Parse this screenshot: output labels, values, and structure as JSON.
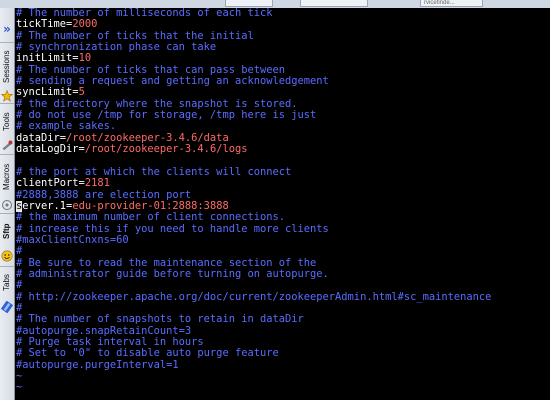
{
  "topbar": {
    "tabs": [
      "",
      "",
      "rvicefinde..."
    ]
  },
  "sidebar": {
    "tabs": [
      {
        "label": "Sessions",
        "icon": "star-icon"
      },
      {
        "label": "Tools",
        "icon": "tools-icon"
      },
      {
        "label": "Macros",
        "icon": "macros-icon"
      },
      {
        "label": "Sftp",
        "icon": "sftp-icon"
      },
      {
        "label": "Tabs",
        "icon": "tabs-icon"
      }
    ]
  },
  "terminal": {
    "lines": [
      {
        "type": "comment",
        "text": "# The number of milliseconds of each tick"
      },
      {
        "type": "kv",
        "key": "tickTime=",
        "value": "2000"
      },
      {
        "type": "comment",
        "text": "# The number of ticks that the initial"
      },
      {
        "type": "comment",
        "text": "# synchronization phase can take"
      },
      {
        "type": "kv",
        "key": "initLimit=",
        "value": "10"
      },
      {
        "type": "comment",
        "text": "# The number of ticks that can pass between"
      },
      {
        "type": "comment",
        "text": "# sending a request and getting an acknowledgement"
      },
      {
        "type": "kv",
        "key": "syncLimit=",
        "value": "5"
      },
      {
        "type": "comment",
        "text": "# the directory where the snapshot is stored."
      },
      {
        "type": "comment",
        "text": "# do not use /tmp for storage, /tmp here is just"
      },
      {
        "type": "comment",
        "text": "# example sakes."
      },
      {
        "type": "kv",
        "key": "dataDir=",
        "value": "/root/zookeeper-3.4.6/data"
      },
      {
        "type": "kv",
        "key": "dataLogDir=",
        "value": "/root/zookeeper-3.4.6/logs"
      },
      {
        "type": "blank",
        "text": ""
      },
      {
        "type": "comment",
        "text": "# the port at which the clients will connect"
      },
      {
        "type": "kv",
        "key": "clientPort=",
        "value": "2181"
      },
      {
        "type": "comment",
        "text": "#2888,3888 are election port"
      },
      {
        "type": "kv",
        "cursor": "s",
        "key": "erver.1=",
        "value": "edu-provider-01:2888:3888"
      },
      {
        "type": "comment",
        "text": "# the maximum number of client connections."
      },
      {
        "type": "comment",
        "text": "# increase this if you need to handle more clients"
      },
      {
        "type": "comment",
        "text": "#maxClientCnxns=60"
      },
      {
        "type": "comment",
        "text": "#"
      },
      {
        "type": "comment",
        "text": "# Be sure to read the maintenance section of the"
      },
      {
        "type": "comment",
        "text": "# administrator guide before turning on autopurge."
      },
      {
        "type": "comment",
        "text": "#"
      },
      {
        "type": "comment",
        "text": "# http://zookeeper.apache.org/doc/current/zookeeperAdmin.html#sc_maintenance"
      },
      {
        "type": "comment",
        "text": "#"
      },
      {
        "type": "comment",
        "text": "# The number of snapshots to retain in dataDir"
      },
      {
        "type": "comment",
        "text": "#autopurge.snapRetainCount=3"
      },
      {
        "type": "comment",
        "text": "# Purge task interval in hours"
      },
      {
        "type": "comment",
        "text": "# Set to \"0\" to disable auto purge feature"
      },
      {
        "type": "comment",
        "text": "#autopurge.purgeInterval=1"
      },
      {
        "type": "tilde",
        "text": "~"
      },
      {
        "type": "tilde",
        "text": "~"
      }
    ]
  },
  "colors": {
    "comment": "#5a6cff",
    "key": "#ffffff",
    "value": "#ff6a6a",
    "background": "#000000"
  }
}
